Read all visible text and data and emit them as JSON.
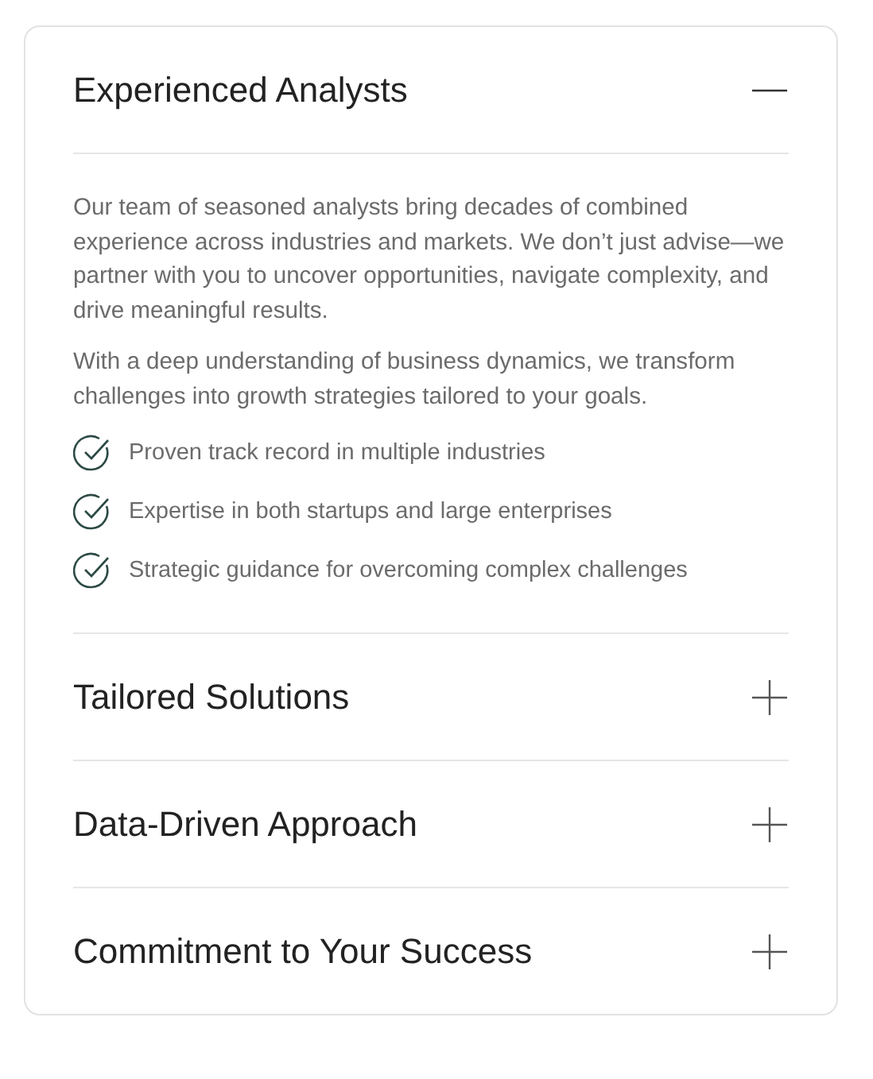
{
  "accordion": [
    {
      "title": "Experienced Analysts",
      "expanded": true,
      "paragraphs": [
        "Our team of seasoned analysts bring decades of combined experience across industries and markets. We don’t just advise—we partner with you to uncover opportunities, navigate complexity, and drive meaningful results.",
        "With a deep understanding of business dynamics, we transform challenges into growth strategies tailored to your goals."
      ],
      "features": [
        "Proven track record in multiple industries",
        "Expertise in both startups and large enterprises",
        "Strategic guidance for overcoming complex challenges"
      ]
    },
    {
      "title": "Tailored Solutions",
      "expanded": false
    },
    {
      "title": "Data-Driven Approach",
      "expanded": false
    },
    {
      "title": "Commitment to Your Success",
      "expanded": false
    }
  ]
}
